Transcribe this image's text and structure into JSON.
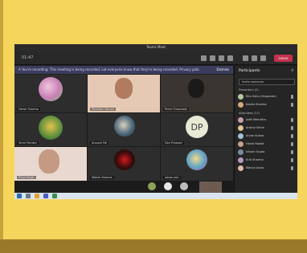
{
  "window": {
    "title": "Teams Meet"
  },
  "toolbar": {
    "clock": "01:47",
    "leave_label": "Leave",
    "icons": [
      "people-icon",
      "chat-icon",
      "reactions-icon",
      "more-icon",
      "camera-icon",
      "mic-icon",
      "share-icon"
    ]
  },
  "banner": {
    "text": "A You're recording: This meeting is being recorded. Let everyone know that they're being recorded. Privacy policy",
    "dismiss_label": "Dismiss"
  },
  "tiles": [
    {
      "name": "Harsh Sharma"
    },
    {
      "name": "Muskaan Bansal"
    },
    {
      "name": "Prem Chaurasia"
    },
    {
      "name": "Viren Pandey"
    },
    {
      "name": "Anoush Pal"
    },
    {
      "name": "Dev Prakash",
      "initials": "DP"
    },
    {
      "name": "Priya Singh"
    },
    {
      "name": "Moksh Khanna"
    },
    {
      "name": "Aarav Jain"
    }
  ],
  "panel": {
    "title": "Participants",
    "invite_placeholder": "Invite someone",
    "section_presenters": "Presenters (2)",
    "section_attendees": "Attendees (17)",
    "presenters": [
      {
        "name": "Ritu Sahu (Organizer)"
      },
      {
        "name": "Kavita Sharma"
      }
    ],
    "attendees": [
      {
        "name": "Aditi Mehrotra"
      },
      {
        "name": "Anshul Sinha"
      },
      {
        "name": "Aryan Kumar"
      },
      {
        "name": "Harsh Rawat"
      },
      {
        "name": "Ishaan Gupta"
      },
      {
        "name": "Kriti Sharma"
      },
      {
        "name": "Manya Arora"
      }
    ]
  },
  "colors": {
    "accent_leave": "#c4314b",
    "wallpaper": "#f6d55c",
    "screen_bg": "#1f1f1f"
  }
}
